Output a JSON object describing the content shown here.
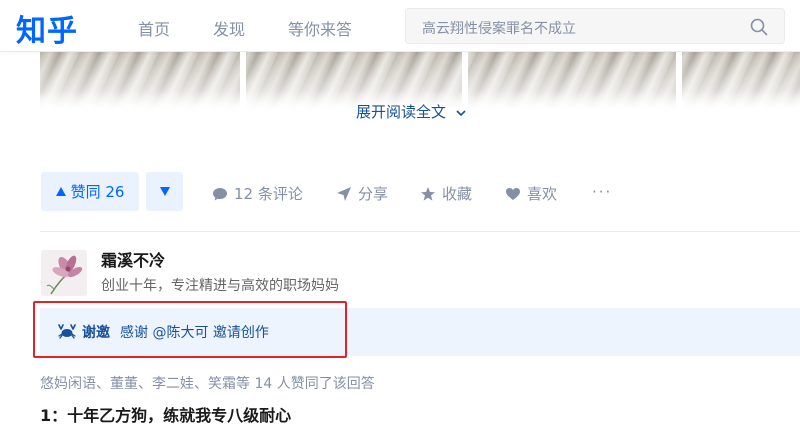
{
  "header": {
    "logo": "知乎",
    "nav": [
      "首页",
      "发现",
      "等你来答"
    ],
    "search_placeholder": "高云翔性侵案罪名不成立"
  },
  "content": {
    "expand_label": "展开阅读全文"
  },
  "actions": {
    "upvote_label": "赞同 26",
    "comments_label": "12 条评论",
    "share_label": "分享",
    "collect_label": "收藏",
    "like_label": "喜欢",
    "more_label": "···"
  },
  "author": {
    "name": "霜溪不冷",
    "bio": "创业十年，专注精进与高效的职场妈妈"
  },
  "invite": {
    "strong": "谢邀",
    "text": "感谢 @陈大可 邀请创作"
  },
  "next_answer": {
    "likers": "悠妈闲语、董董、李二娃、笑霜等 14 人赞同了该回答",
    "title": "1：十年乙方狗，练就我专八级耐心"
  },
  "colors": {
    "brand": "#0066ff",
    "link": "#175199",
    "highlight_border": "#e0242a"
  }
}
